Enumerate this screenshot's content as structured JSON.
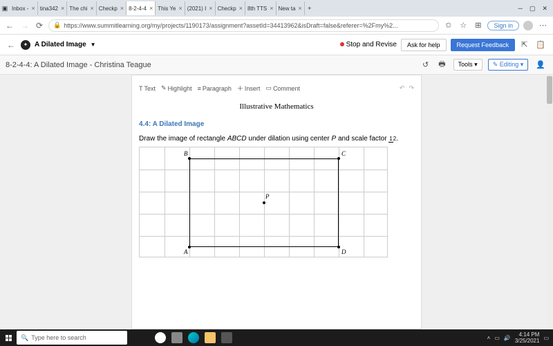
{
  "browser": {
    "tabs": [
      {
        "label": "Inbox -"
      },
      {
        "label": "tina342"
      },
      {
        "label": "The chi"
      },
      {
        "label": "Checkp"
      },
      {
        "label": "8-2-4-4",
        "active": true
      },
      {
        "label": "This Ye"
      },
      {
        "label": "(2021) I"
      },
      {
        "label": "Checkp"
      },
      {
        "label": "8th TTS"
      },
      {
        "label": "New ta"
      }
    ],
    "url": "https://www.summitlearning.org/my/projects/1190173/assignment?assetId=34413962&isDraft=false&referer=%2Fmy%2...",
    "signin": "Sign in"
  },
  "app": {
    "back": "←",
    "title": "A Dilated Image",
    "stop_revise": "Stop and Revise",
    "ask_help": "Ask for help",
    "request_feedback": "Request Feedback"
  },
  "sub": {
    "title": "8-2-4-4: A Dilated Image - Christina Teague",
    "tools": "Tools",
    "editing": "Editing"
  },
  "toolbar": {
    "text": "Text",
    "highlight": "Highlight",
    "paragraph": "Paragraph",
    "insert": "Insert",
    "comment": "Comment"
  },
  "doc": {
    "brand": "Illustrative Mathematics",
    "section": "4.4: A Dilated Image",
    "instr_a": "Draw the image of rectangle ",
    "instr_abcd": "ABCD",
    "instr_b": " under dilation using center ",
    "instr_p": "P",
    "instr_c": " and scale factor ",
    "frac_top": "1",
    "frac_bot": "2",
    "period": ".",
    "labels": {
      "A": "A",
      "B": "B",
      "C": "C",
      "D": "D",
      "P": "P"
    }
  },
  "taskbar": {
    "search_placeholder": "Type here to search",
    "time": "4:14 PM",
    "date": "3/25/2021"
  }
}
